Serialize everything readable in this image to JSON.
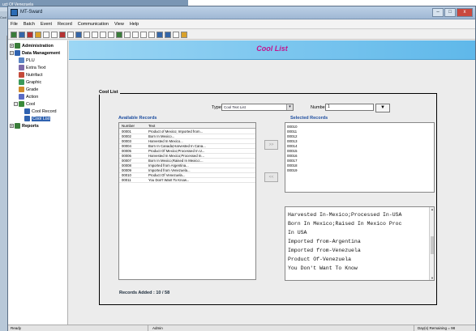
{
  "background_window": {
    "title": "uct Of Venezuela",
    "side_label": "Cool"
  },
  "window": {
    "title": "MT-Sward",
    "buttons": {
      "minimize": "–",
      "maximize": "□",
      "close": "x"
    }
  },
  "menu": [
    "File",
    "Batch",
    "Event",
    "Record",
    "Communication",
    "View",
    "Help"
  ],
  "sidebar": {
    "items": [
      {
        "label": "Administration",
        "toggle": "+",
        "bold": true
      },
      {
        "label": "Data Management",
        "toggle": "−",
        "bold": true
      },
      {
        "label": "PLU"
      },
      {
        "label": "Extra Text"
      },
      {
        "label": "Nutrifact"
      },
      {
        "label": "Graphic"
      },
      {
        "label": "Grade"
      },
      {
        "label": "Action"
      },
      {
        "label": "Cool",
        "toggle": "−"
      },
      {
        "label": "Cool Record"
      },
      {
        "label": "Cool List"
      },
      {
        "label": "Reports",
        "toggle": "+",
        "bold": true
      }
    ]
  },
  "page": {
    "title": "Cool List"
  },
  "form": {
    "group_label": "Cool List",
    "type_label": "Type",
    "type_value": "Cool Text List",
    "number_label": "Number",
    "number_value": "1"
  },
  "available": {
    "heading": "Available Records",
    "columns": [
      "Number",
      "Text"
    ],
    "rows": [
      {
        "number": "00001",
        "text": "Product of Mexico; Imported from..."
      },
      {
        "number": "00002",
        "text": "Born In Mexico..."
      },
      {
        "number": "00003",
        "text": "Harvested In Mexico..."
      },
      {
        "number": "00004",
        "text": "Born In Canada;Harvested In Cana..."
      },
      {
        "number": "00005",
        "text": "Product Of Mexico;Processed In U..."
      },
      {
        "number": "00006",
        "text": "Harvested In Mexico;Processed In..."
      },
      {
        "number": "00007",
        "text": "Born In Mexico;Raised In Mexico:..."
      },
      {
        "number": "00008",
        "text": "Imported from Argentina..."
      },
      {
        "number": "00009",
        "text": "Imported from Venezuela..."
      },
      {
        "number": "00010",
        "text": "Product Of Venezuela..."
      },
      {
        "number": "00011",
        "text": "You Don't Want To Know..."
      }
    ]
  },
  "move_buttons": {
    "add": ">>",
    "remove": "<<"
  },
  "selected": {
    "heading": "Selected Records",
    "rows": [
      "00010",
      "00011",
      "00012",
      "00013",
      "00014",
      "00015",
      "00016",
      "00017",
      "00018",
      "00019"
    ]
  },
  "detail_text": [
    "Harvested In-Mexico;Processed In-USA",
    "Born In Mexico;Raised In Mexico Proc",
    "In USA",
    "Imported from-Argentina",
    "Imported from-Venezuela",
    "Product Of-Venezuela",
    "You Don't Want To Know"
  ],
  "records_added": "Records Added : 10 / 58",
  "status": {
    "left": "Ready",
    "user": "Admin",
    "right": "Day(s) Remaining = 98"
  }
}
